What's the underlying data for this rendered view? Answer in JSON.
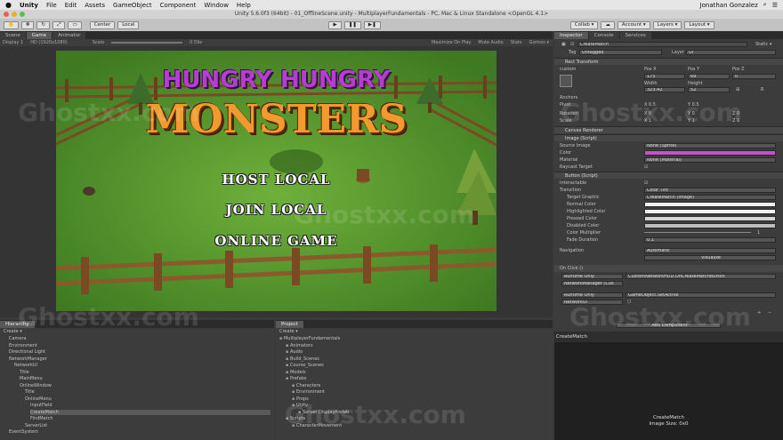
{
  "mac_menu": {
    "app": "Unity",
    "items": [
      "File",
      "Edit",
      "Assets",
      "GameObject",
      "Component",
      "Window",
      "Help"
    ],
    "user": "Jonathan Gonzalez"
  },
  "window_title": "Unity 5.6.0f3 (64bit) - 01_OfflineScene.unity - MultiplayerFundamentals - PC, Mac & Linux Standalone <OpenGL 4.1>",
  "toolbar": {
    "center": "Center",
    "local": "Local",
    "collab": "Collab ▾",
    "account": "Account ▾",
    "layers": "Layers ▾",
    "layout": "Layout ▾"
  },
  "scene_tabs": {
    "scene": "Scene",
    "game": "Game",
    "animator": "Animator"
  },
  "game_bar": {
    "display": "Display 1",
    "resolution": "HD (1920x1080)",
    "scale_label": "Scale",
    "scale_value": "0.59x",
    "maximize": "Maximize On Play",
    "mute": "Mute Audio",
    "stats": "Stats",
    "gizmos": "Gizmos ▾"
  },
  "game_view": {
    "title_line1": "HUNGRY HUNGRY",
    "title_line2": "MONSTERS",
    "menu": [
      "HOST LOCAL",
      "JOIN LOCAL",
      "ONLINE GAME"
    ]
  },
  "inspector_tabs": {
    "inspector": "Inspector",
    "console": "Console",
    "services": "Services"
  },
  "inspector": {
    "object_name": "CreateMatch",
    "static_label": "Static ▾",
    "tag_label": "Tag",
    "tag_value": "Untagged",
    "layer_label": "Layer",
    "layer_value": "UI",
    "rect_transform": "Rect Transform",
    "anchor_label": "custom",
    "pos_x_label": "Pos X",
    "pos_y_label": "Pos Y",
    "pos_z_label": "Pos Z",
    "pos_x": "175",
    "pos_y": "69",
    "pos_z": "0",
    "width_label": "Width",
    "height_label": "Height",
    "width": "323.42",
    "height": "52",
    "r_btn": "R",
    "anchors": "Anchors",
    "pivot_label": "Pivot",
    "pivot_x": "X  0.5",
    "pivot_y": "Y  0.5",
    "rotation_label": "Rotation",
    "rot_x": "X  0",
    "rot_y": "Y  0",
    "rot_z": "Z  0",
    "scale_label": "Scale",
    "scale_x": "X  1",
    "scale_y": "Y  1",
    "scale_z": "Z  1",
    "canvas_renderer": "Canvas Renderer",
    "image_script": "Image (Script)",
    "source_image_label": "Source Image",
    "source_image": "None (Sprite)",
    "color_label": "Color",
    "material_label": "Material",
    "material": "None (Material)",
    "raycast_label": "Raycast Target",
    "button_script": "Button (Script)",
    "interactable_label": "Interactable",
    "transition_label": "Transition",
    "transition": "Color Tint",
    "target_graphic_label": "Target Graphic",
    "target_graphic": "CreateMatch (Image)",
    "normal_label": "Normal Color",
    "highlighted_label": "Highlighted Color",
    "pressed_label": "Pressed Color",
    "disabled_label": "Disabled Color",
    "multiplier_label": "Color Multiplier",
    "multiplier": "1",
    "fade_label": "Fade Duration",
    "fade": "0.1",
    "navigation_label": "Navigation",
    "navigation": "Automatic",
    "visualize": "Visualize",
    "onclick": "On Click ()",
    "runtime1": "Runtime Only",
    "func1": "CustomNetworkHUD.OnCreateMatchButton",
    "obj1": "NetworkManager (Cus",
    "runtime2": "Runtime Only",
    "func2": "GameObject.SetActive",
    "obj2": "NetworkUI",
    "add_component": "Add Component"
  },
  "preview": {
    "name": "CreateMatch",
    "size_label": "CreateMatch",
    "size": "Image Size: 0x0"
  },
  "hierarchy": {
    "tab": "Hierarchy",
    "create": "Create ▾",
    "items": [
      {
        "label": "Camera",
        "indent": 1
      },
      {
        "label": "Environment",
        "indent": 1
      },
      {
        "label": "Directional Light",
        "indent": 1
      },
      {
        "label": "NetworkManager",
        "indent": 1
      },
      {
        "label": "NetworkUI",
        "indent": 2
      },
      {
        "label": "Title",
        "indent": 3
      },
      {
        "label": "MainMenu",
        "indent": 3
      },
      {
        "label": "OnlineWindow",
        "indent": 3
      },
      {
        "label": "Title",
        "indent": 4
      },
      {
        "label": "OnlineMenu",
        "indent": 4
      },
      {
        "label": "InputField",
        "indent": 5
      },
      {
        "label": "CreateMatch",
        "indent": 5
      },
      {
        "label": "FindMatch",
        "indent": 5
      },
      {
        "label": "ServerList",
        "indent": 4
      },
      {
        "label": "EventSystem",
        "indent": 1
      }
    ]
  },
  "project": {
    "tab": "Project",
    "create": "Create ▾",
    "items": [
      {
        "label": "MultiplayerFundamentals",
        "indent": 0
      },
      {
        "label": "Animators",
        "indent": 1
      },
      {
        "label": "Audio",
        "indent": 1
      },
      {
        "label": "Build_Scenes",
        "indent": 1
      },
      {
        "label": "Course_Scenes",
        "indent": 1
      },
      {
        "label": "Models",
        "indent": 1
      },
      {
        "label": "Prefabs",
        "indent": 1
      },
      {
        "label": "Characters",
        "indent": 2
      },
      {
        "label": "Environment",
        "indent": 2
      },
      {
        "label": "Props",
        "indent": 2
      },
      {
        "label": "Unity",
        "indent": 2
      },
      {
        "label": "Server DisplayPrefab",
        "indent": 3
      },
      {
        "label": "Scripts",
        "indent": 1
      },
      {
        "label": "CharacterMovement",
        "indent": 2
      }
    ]
  },
  "watermark": "Ghostxx.com",
  "colors": {
    "image_color": "#c451c8",
    "normal": "#f2f2f2"
  }
}
